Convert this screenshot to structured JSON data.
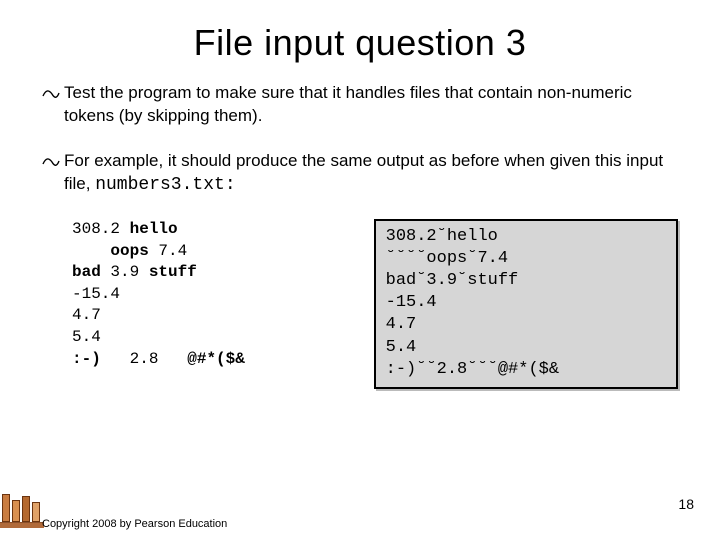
{
  "title": "File input question 3",
  "bullets": {
    "b1": "Test the program to make sure that it handles files that contain non-numeric tokens (by skipping them).",
    "b2_pre": "For example, it should produce the same output as before when given this input file, ",
    "b2_filename": "numbers3.txt",
    "b2_colon": ":"
  },
  "left_code": {
    "l1a": "308.2 ",
    "l1b": "hello",
    "l2a": "    ",
    "l2b": "oops",
    "l2c": " 7.4",
    "l3a": "bad",
    "l3b": " 3.9 ",
    "l3c": "stuff",
    "l4": "-15.4",
    "l5": "4.7",
    "l6": "5.4",
    "l7a": ":-)",
    "l7b": "   2.8   ",
    "l7c": "@#*($&"
  },
  "right_code": "308.2˘hello\n˘˘˘˘oops˘7.4\nbad˘3.9˘stuff\n-15.4\n4.7\n5.4\n:-)˘˘2.8˘˘˘@#*($&",
  "copyright": "Copyright 2008 by Pearson Education",
  "page_number": "18"
}
